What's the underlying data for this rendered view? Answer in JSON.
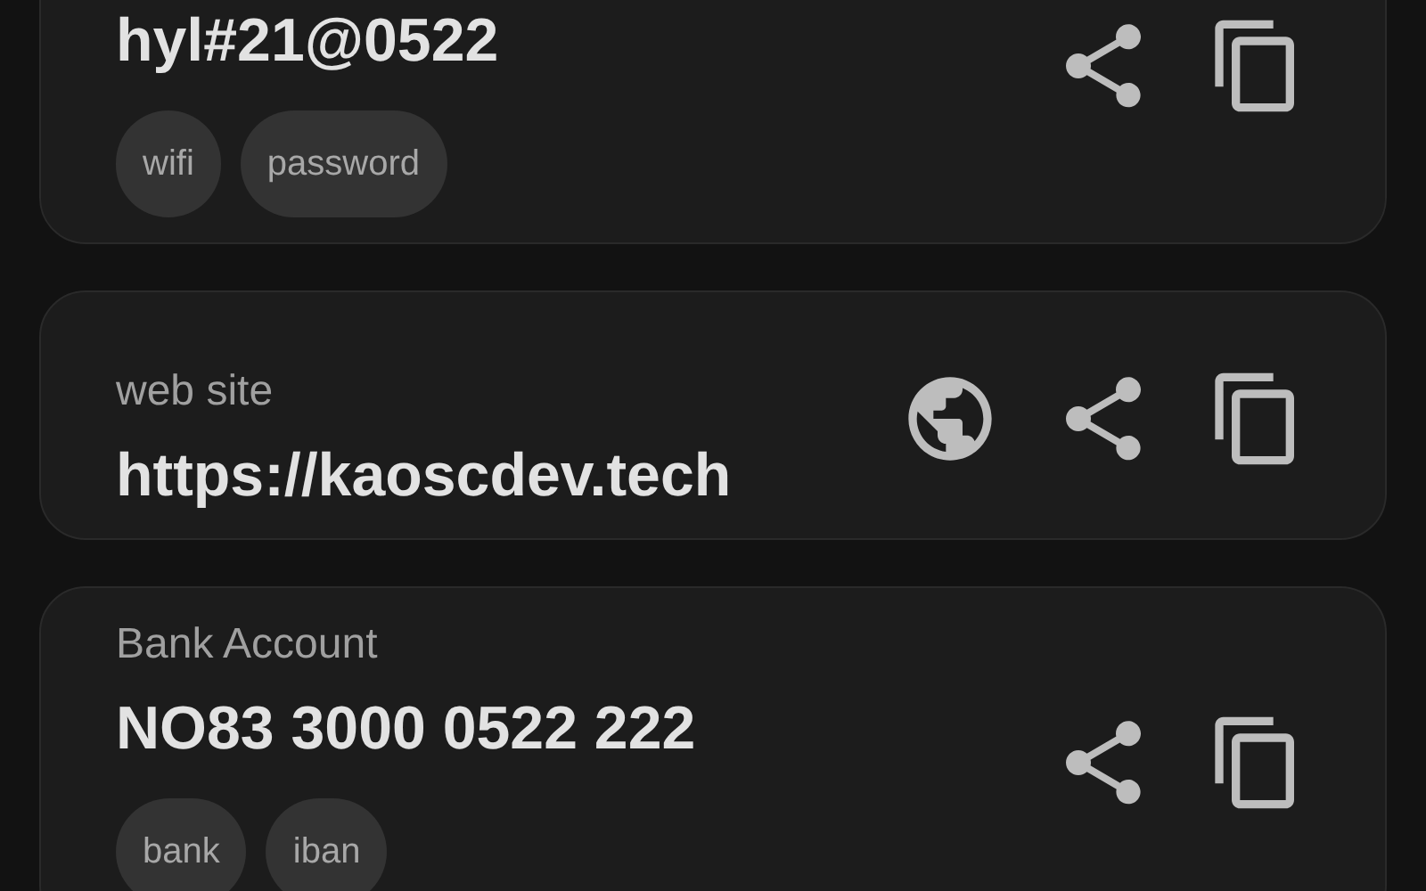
{
  "cards": [
    {
      "value": "hyl#21@0522",
      "tags": [
        "wifi",
        "password"
      ],
      "actions": [
        {
          "kind": "share"
        },
        {
          "kind": "copy"
        }
      ]
    },
    {
      "label": "web site",
      "value": "https://kaoscdev.tech",
      "actions": [
        {
          "kind": "open-web"
        },
        {
          "kind": "share"
        },
        {
          "kind": "copy"
        }
      ]
    },
    {
      "label": "Bank Account",
      "value": "NO83 3000 0522 222",
      "tags": [
        "bank",
        "iban"
      ],
      "actions": [
        {
          "kind": "share"
        },
        {
          "kind": "copy"
        }
      ]
    }
  ]
}
